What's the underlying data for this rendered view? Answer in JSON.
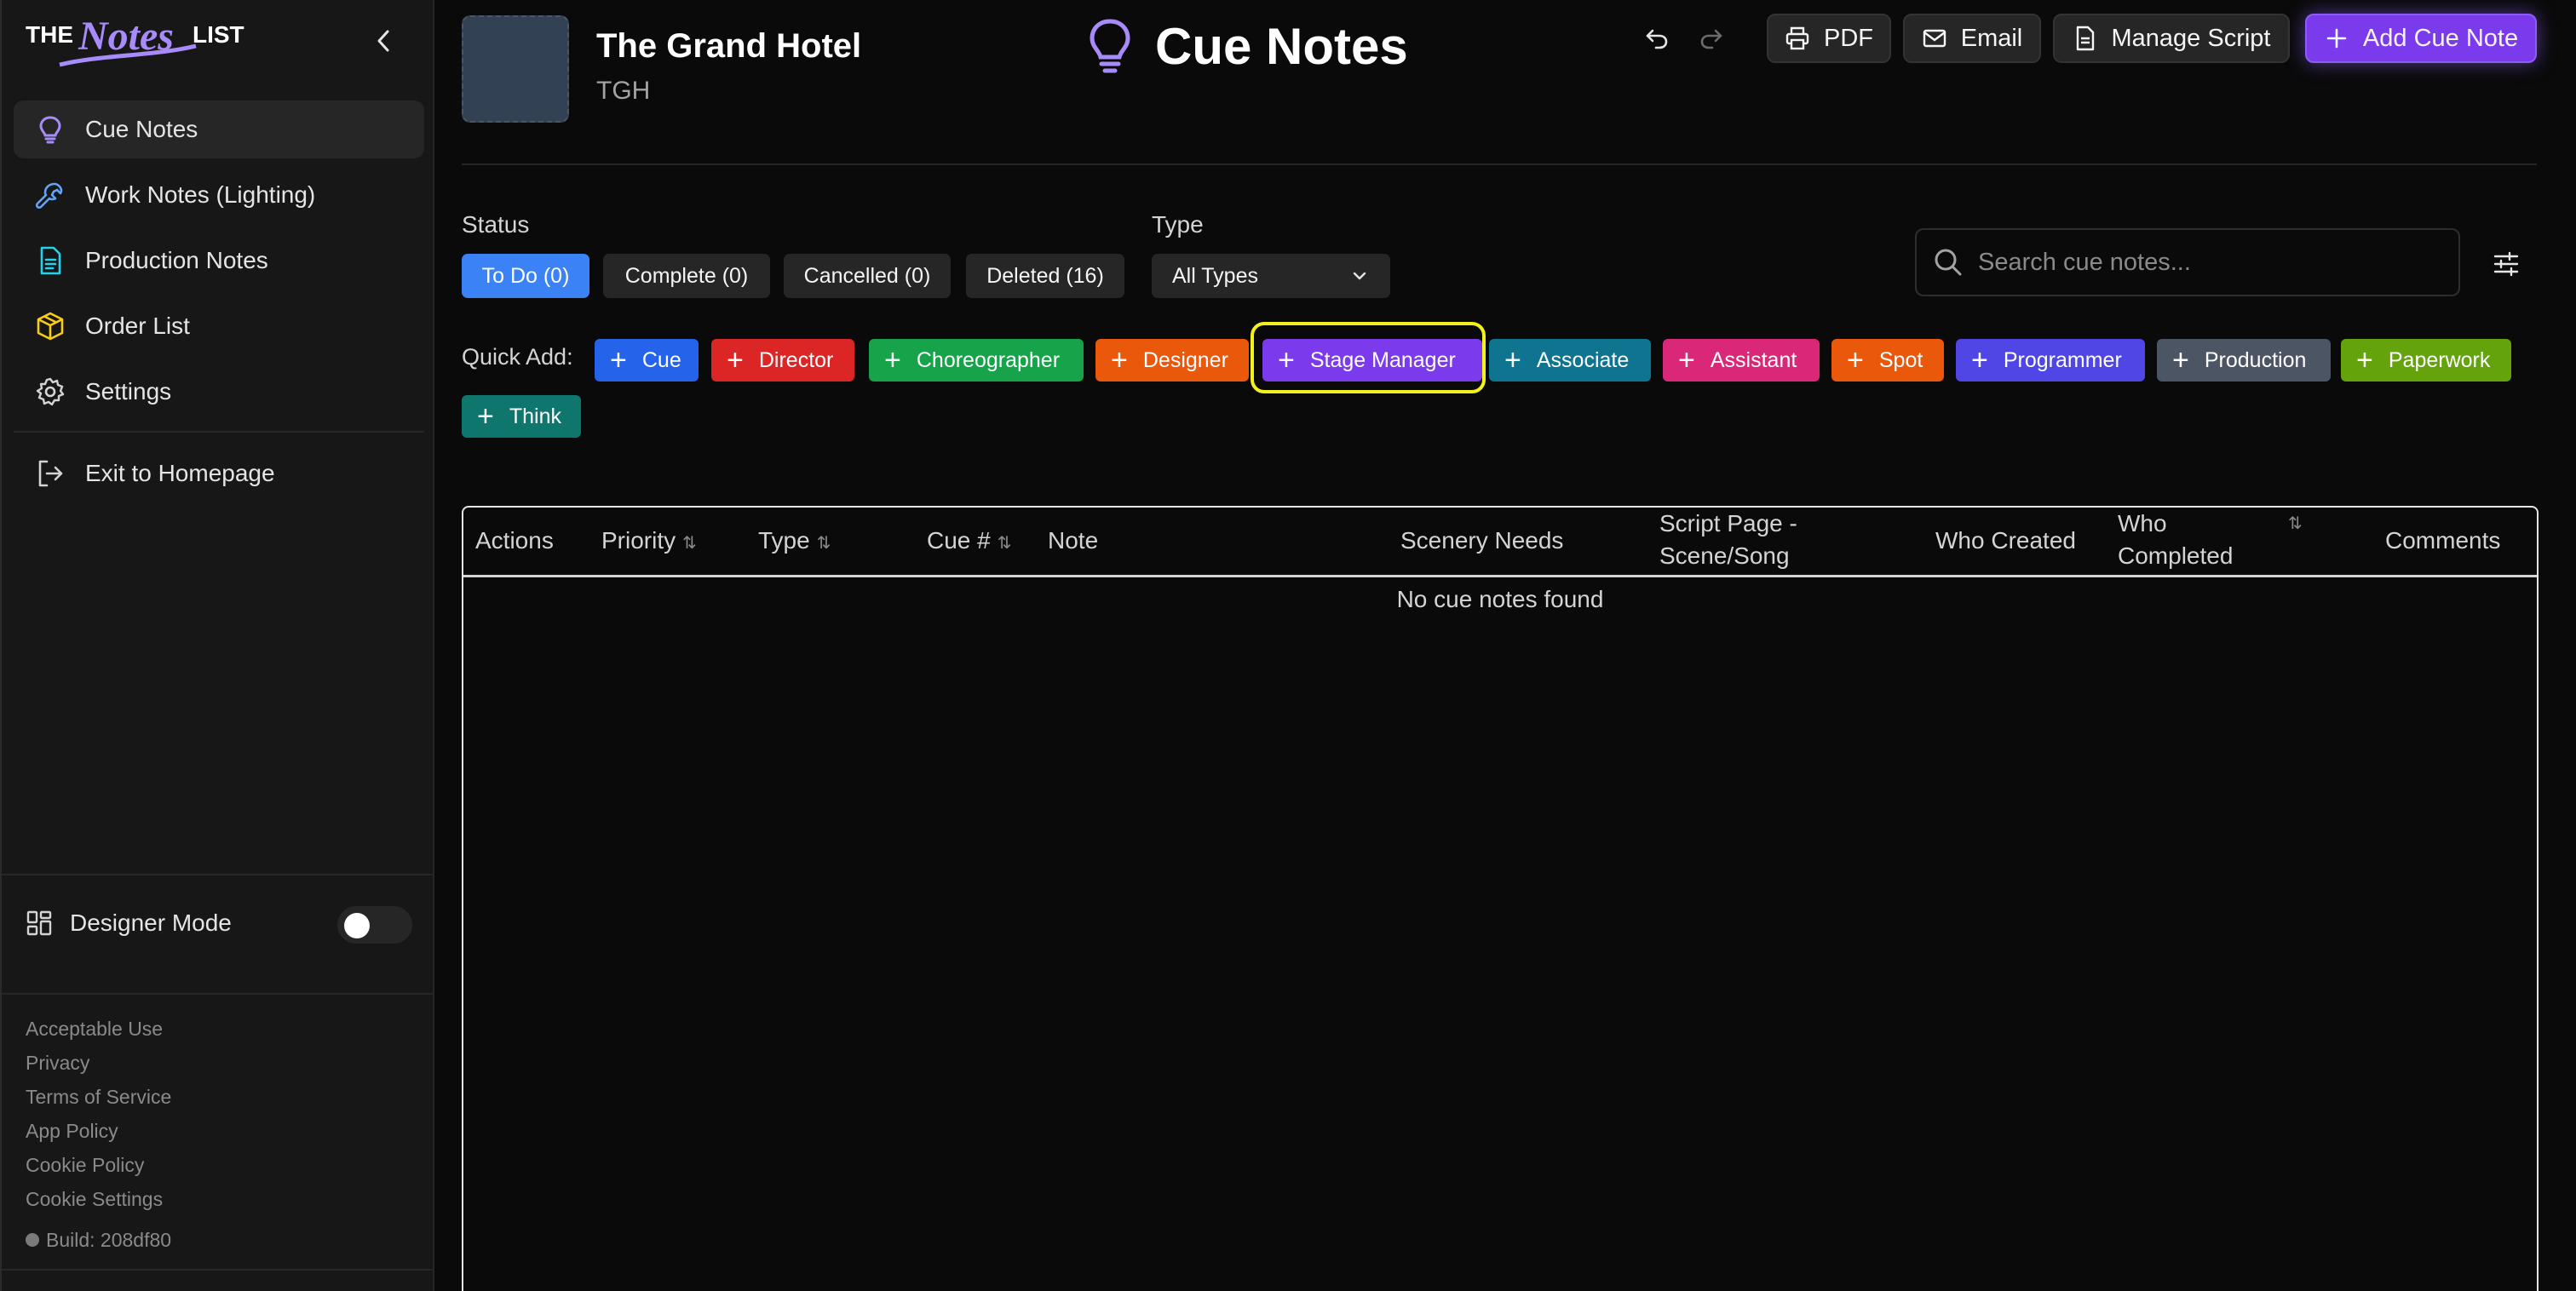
{
  "app": {
    "logo_text": "THE Notes LIST"
  },
  "sidebar": {
    "items": [
      {
        "label": "Cue Notes",
        "icon": "lightbulb-icon",
        "active": true
      },
      {
        "label": "Work Notes (Lighting)",
        "icon": "wrench-icon"
      },
      {
        "label": "Production Notes",
        "icon": "document-icon"
      },
      {
        "label": "Order List",
        "icon": "package-icon"
      },
      {
        "label": "Settings",
        "icon": "gear-icon"
      },
      {
        "label": "Exit to Homepage",
        "icon": "logout-icon"
      }
    ],
    "designer_mode_label": "Designer Mode",
    "designer_mode_on": false,
    "footer_links": [
      "Acceptable Use",
      "Privacy",
      "Terms of Service",
      "App Policy",
      "Cookie Policy",
      "Cookie Settings"
    ],
    "build": "Build: 208df80"
  },
  "header": {
    "production_title": "The Grand Hotel",
    "production_abbr": "TGH",
    "page_title": "Cue Notes",
    "buttons": {
      "pdf": "PDF",
      "email": "Email",
      "manage_script": "Manage Script",
      "add_cue_note": "Add Cue Note"
    }
  },
  "filters": {
    "status_label": "Status",
    "status_chips": [
      "To Do (0)",
      "Complete (0)",
      "Cancelled (0)",
      "Deleted (16)"
    ],
    "active_status": "To Do (0)",
    "type_label": "Type",
    "type_value": "All Types",
    "search_placeholder": "Search cue notes..."
  },
  "quick_add": {
    "label": "Quick Add:",
    "buttons": [
      {
        "label": "Cue",
        "color": "#2563eb"
      },
      {
        "label": "Director",
        "color": "#dc2626"
      },
      {
        "label": "Choreographer",
        "color": "#16a34a"
      },
      {
        "label": "Designer",
        "color": "#ea580c"
      },
      {
        "label": "Stage Manager",
        "color": "#7c3aed",
        "highlighted": true
      },
      {
        "label": "Associate",
        "color": "#0e7490"
      },
      {
        "label": "Assistant",
        "color": "#db2777"
      },
      {
        "label": "Spot",
        "color": "#ea580c"
      },
      {
        "label": "Programmer",
        "color": "#4f46e5"
      },
      {
        "label": "Production",
        "color": "#4b5563"
      },
      {
        "label": "Paperwork",
        "color": "#65a30d"
      },
      {
        "label": "Think",
        "color": "#0f766e"
      }
    ]
  },
  "table": {
    "columns": [
      "Actions",
      "Priority",
      "Type",
      "Cue #",
      "Note",
      "Scenery Needs",
      "Script Page -\nScene/Song",
      "Who Created",
      "Who\nCompleted",
      "Comments"
    ],
    "empty_message": "No cue notes found"
  }
}
